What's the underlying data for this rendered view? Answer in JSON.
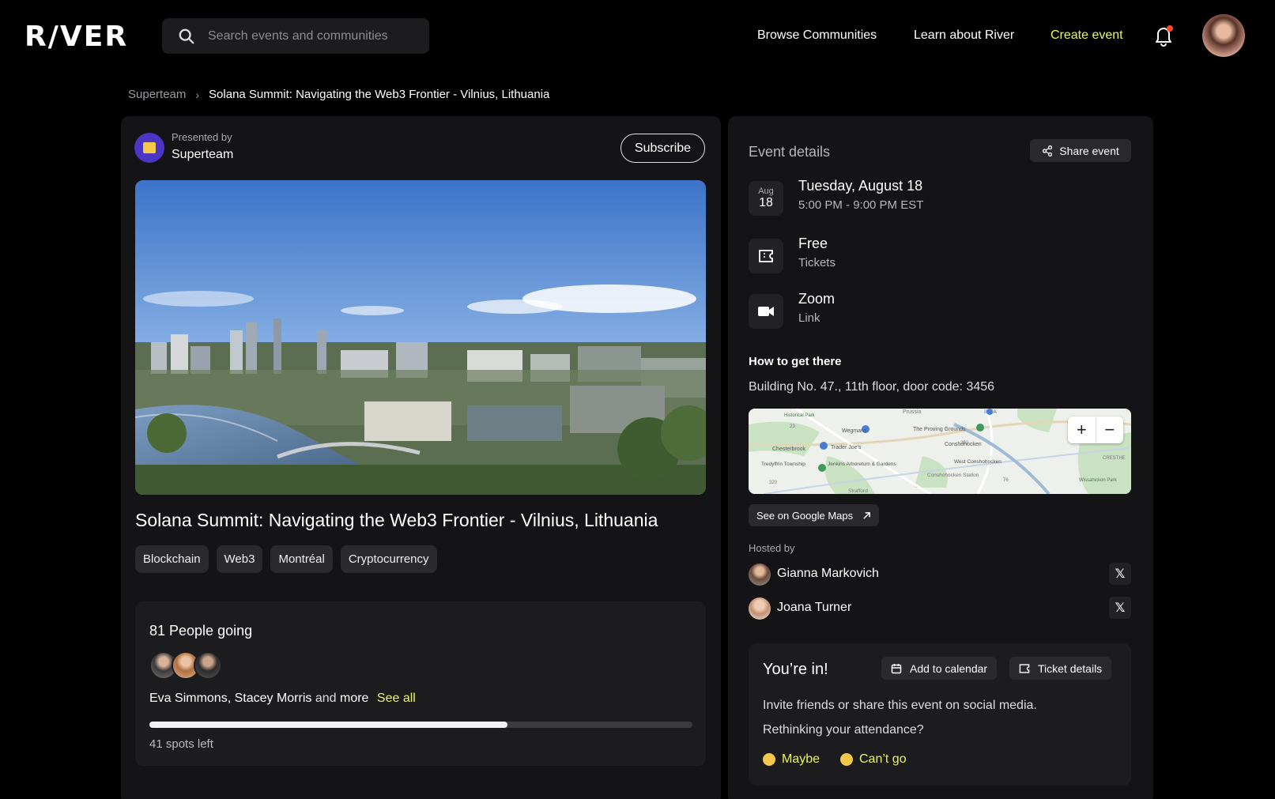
{
  "header": {
    "logo": "R/VER",
    "search_placeholder": "Search events and communities",
    "nav": {
      "browse": "Browse Communities",
      "learn": "Learn about River",
      "create": "Create event"
    },
    "accent_color": "#ecf45c"
  },
  "breadcrumb": {
    "parent": "Superteam",
    "current": "Solana Summit: Navigating the Web3 Frontier - Vilnius, Lithuania"
  },
  "presenter": {
    "label": "Presented by",
    "name": "Superteam",
    "subscribe_label": "Subscribe"
  },
  "event": {
    "title": "Solana Summit: Navigating the Web3 Frontier - Vilnius, Lithuania",
    "tags": [
      "Blockchain",
      "Web3",
      "Montréal",
      "Cryptocurrency"
    ]
  },
  "attendance": {
    "title": "81 People going",
    "names": "Eva Simmons, Stacey Morris",
    "and_text": "and",
    "more_text": "more",
    "see_all": "See all",
    "progress_fraction": 0.66,
    "spots_left": "41 spots left"
  },
  "details": {
    "title": "Event details",
    "share_label": "Share event",
    "date": {
      "month": "Aug",
      "day": "18",
      "main": "Tuesday, August 18",
      "sub": "5:00 PM - 9:00 PM EST"
    },
    "tickets": {
      "main": "Free",
      "sub": "Tickets"
    },
    "location": {
      "main": "Zoom",
      "sub": "Link"
    },
    "how_title": "How to get there",
    "how_text": "Building No. 47., 11th floor, door code: 3456",
    "maps_label": "See on Google Maps",
    "map_labels": {
      "prussia": "Prussia",
      "kea": "IKEA",
      "proving": "The Proving Grounds",
      "wegmans": "Wegmans",
      "conshohocken": "Conshohocken",
      "traderjoes": "Trader Joe's",
      "chesterbrook": "Chesterbrook",
      "west_consh": "West Conshohocken",
      "tredyffrin": "Tredyffrin Township",
      "jenkins": "Jenkins Arboretum & Gardens",
      "consh_station": "Conshohocken Station",
      "strafford": "Strafford",
      "cresthe": "CRESTHE",
      "wissahickon": "Wissahickon Park",
      "hist_park": "Historical Park",
      "r23": "23",
      "r202": "202",
      "r320": "320",
      "r76": "76"
    },
    "hosted_label": "Hosted by",
    "hosts": [
      {
        "name": "Gianna Markovich",
        "x": "𝕏"
      },
      {
        "name": "Joana Turner",
        "x": "𝕏"
      }
    ]
  },
  "rsvp": {
    "title": "You’re in!",
    "add_calendar": "Add to calendar",
    "ticket_details": "Ticket details",
    "invite_text": "Invite friends or share this event on social media.",
    "rethink_text": "Rethinking your attendance?",
    "maybe": "Maybe",
    "cant_go": "Can’t go"
  }
}
